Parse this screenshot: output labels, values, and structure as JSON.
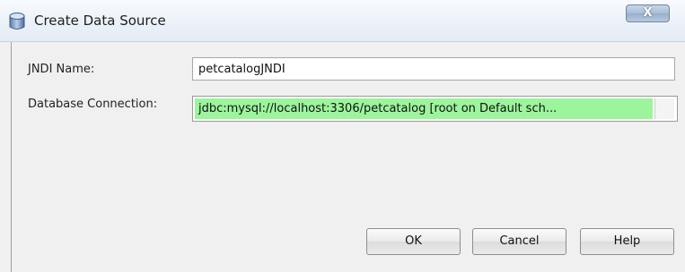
{
  "window": {
    "title": "Create Data Source",
    "close_label": "X"
  },
  "form": {
    "jndi_label": "JNDI Name:",
    "jndi_value": "petcatalogJNDI",
    "connection_label": "Database Connection:",
    "connection_value": "jdbc:mysql://localhost:3306/petcatalog [root on Default sch..."
  },
  "buttons": {
    "ok": "OK",
    "cancel": "Cancel",
    "help": "Help"
  },
  "colors": {
    "selected_connection_bg": "#9cf59c"
  }
}
